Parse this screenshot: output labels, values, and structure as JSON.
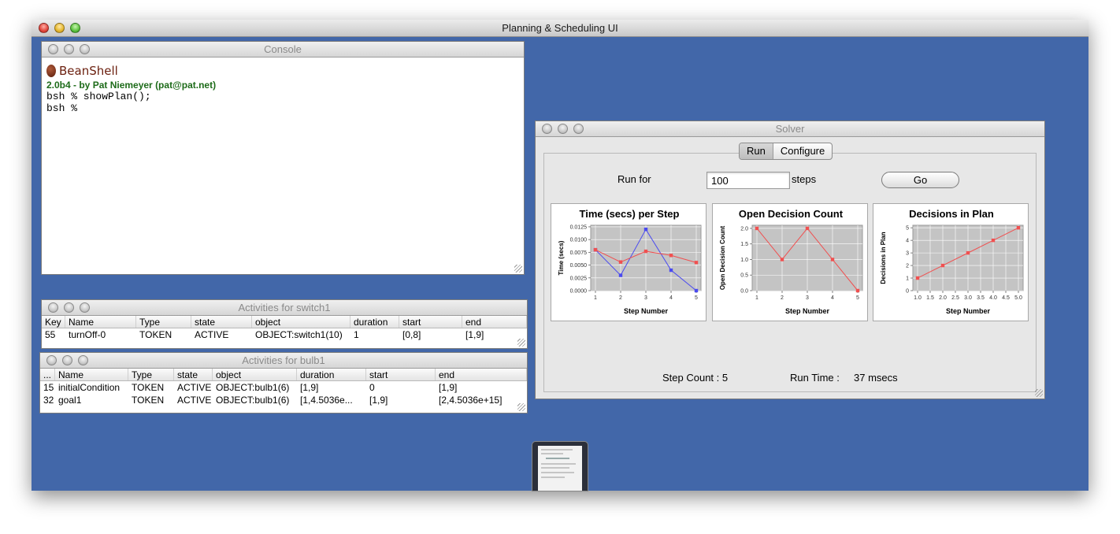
{
  "app": {
    "title": "Planning & Scheduling UI",
    "desktop_color": "#4267a9"
  },
  "console": {
    "title": "Console",
    "brand": "BeanShell",
    "version_line": "2.0b4 - by Pat Niemeyer (pat@pat.net)",
    "lines": [
      "bsh % showPlan();",
      "bsh %"
    ]
  },
  "switch1_table": {
    "title": "Activities for switch1",
    "columns": [
      "Key",
      "Name",
      "Type",
      "state",
      "object",
      "duration",
      "start",
      "end"
    ],
    "rows": [
      [
        "55",
        "turnOff-0",
        "TOKEN",
        "ACTIVE",
        "OBJECT:switch1(10)",
        "1",
        "[0,8]",
        "[1,9]"
      ]
    ]
  },
  "bulb1_table": {
    "title": "Activities for bulb1",
    "columns": [
      "...",
      "Name",
      "Type",
      "state",
      "object",
      "duration",
      "start",
      "end"
    ],
    "rows": [
      [
        "15",
        "initialCondition",
        "TOKEN",
        "ACTIVE",
        "OBJECT:bulb1(6)",
        "[1,9]",
        "0",
        "[1,9]"
      ],
      [
        "32",
        "goal1",
        "TOKEN",
        "ACTIVE",
        "OBJECT:bulb1(6)",
        "[1,4.5036e...",
        "[1,9]",
        "[2,4.5036e+15]"
      ]
    ]
  },
  "solver": {
    "title": "Solver",
    "tabs": [
      "Run",
      "Configure"
    ],
    "selected_tab": "Run",
    "run_for_label": "Run for",
    "steps_value": "100",
    "steps_label": "steps",
    "go_label": "Go",
    "step_count_label": "Step Count : 5",
    "run_time_label": "Run Time :",
    "run_time_value": "37 msecs"
  },
  "chart_data": [
    {
      "type": "line",
      "title": "Time (secs) per Step",
      "xlabel": "Step Number",
      "ylabel": "Time (secs)",
      "x": [
        1,
        2,
        3,
        4,
        5
      ],
      "xticks": [
        "1",
        "2",
        "3",
        "4",
        "5"
      ],
      "yticks": [
        "0.0000",
        "0.0025",
        "0.0050",
        "0.0075",
        "0.0100",
        "0.0125"
      ],
      "ylim": [
        0,
        0.0128
      ],
      "series": [
        {
          "values": [
            0.008,
            0.003,
            0.012,
            0.004,
            0.0
          ],
          "color": "#4a4af0"
        },
        {
          "values": [
            0.008,
            0.0056,
            0.0077,
            0.0069,
            0.0055
          ],
          "color": "#f05050"
        }
      ]
    },
    {
      "type": "line",
      "title": "Open Decision Count",
      "xlabel": "Step Number",
      "ylabel": "Open Decision Count",
      "x": [
        1,
        2,
        3,
        4,
        5
      ],
      "xticks": [
        "1",
        "2",
        "3",
        "4",
        "5"
      ],
      "yticks": [
        "0.0",
        "0.5",
        "1.0",
        "1.5",
        "2.0"
      ],
      "ylim": [
        0,
        2.1
      ],
      "series": [
        {
          "values": [
            2,
            1,
            2,
            1,
            0
          ],
          "color": "#f05050"
        }
      ]
    },
    {
      "type": "line",
      "title": "Decisions in Plan",
      "xlabel": "Step Number",
      "ylabel": "Decisions in Plan",
      "x": [
        1,
        2,
        3,
        4,
        5
      ],
      "xticks": [
        "1.0",
        "1.5",
        "2.0",
        "2.5",
        "3.0",
        "3.5",
        "4.0",
        "4.5",
        "5.0"
      ],
      "yticks": [
        "0",
        "1",
        "2",
        "3",
        "4",
        "5"
      ],
      "ylim": [
        0,
        5.2
      ],
      "series": [
        {
          "values": [
            1,
            2,
            3,
            4,
            5
          ],
          "color": "#f05050"
        }
      ]
    }
  ]
}
